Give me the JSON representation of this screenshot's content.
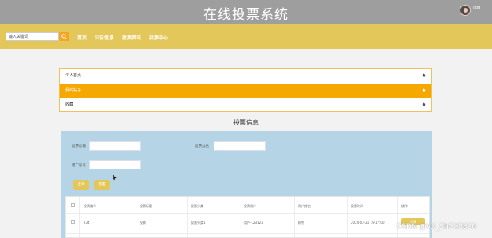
{
  "header": {
    "site_title": "在线投票系统",
    "user_name": "jigg"
  },
  "navbar": {
    "search_placeholder": "输入关键词",
    "links": [
      "首页",
      "公告信息",
      "投票资讯",
      "投票中心"
    ]
  },
  "side_menu": {
    "items": [
      {
        "label": "个人首页",
        "active": false
      },
      {
        "label": "我的帖子",
        "active": true
      },
      {
        "label": "收藏",
        "active": false
      }
    ]
  },
  "section_title": "投票信息",
  "filters": {
    "fields": [
      {
        "label": "投票标题",
        "value": ""
      },
      {
        "label": "投票分类",
        "value": ""
      },
      {
        "label": "用户账号",
        "value": ""
      }
    ],
    "buttons": [
      "查询",
      "重置"
    ]
  },
  "table": {
    "columns": [
      "投票编号",
      "投票标题",
      "投票分类",
      "投票用户",
      "用户姓名",
      "投票时间",
      "操作"
    ],
    "rows": [
      {
        "cells": [
          "234",
          "投票",
          "投票分类1",
          "用户-123123",
          "柳钞",
          "2024-03-21 19:17:00"
        ],
        "action": "详情"
      }
    ]
  },
  "watermark": "CSDN @VX_ShCX8820",
  "colors": {
    "topbar": "#9e9e9e",
    "navbar": "#e3c75a",
    "accent_orange": "#f5a800",
    "panel_blue": "#b5d5e6"
  }
}
